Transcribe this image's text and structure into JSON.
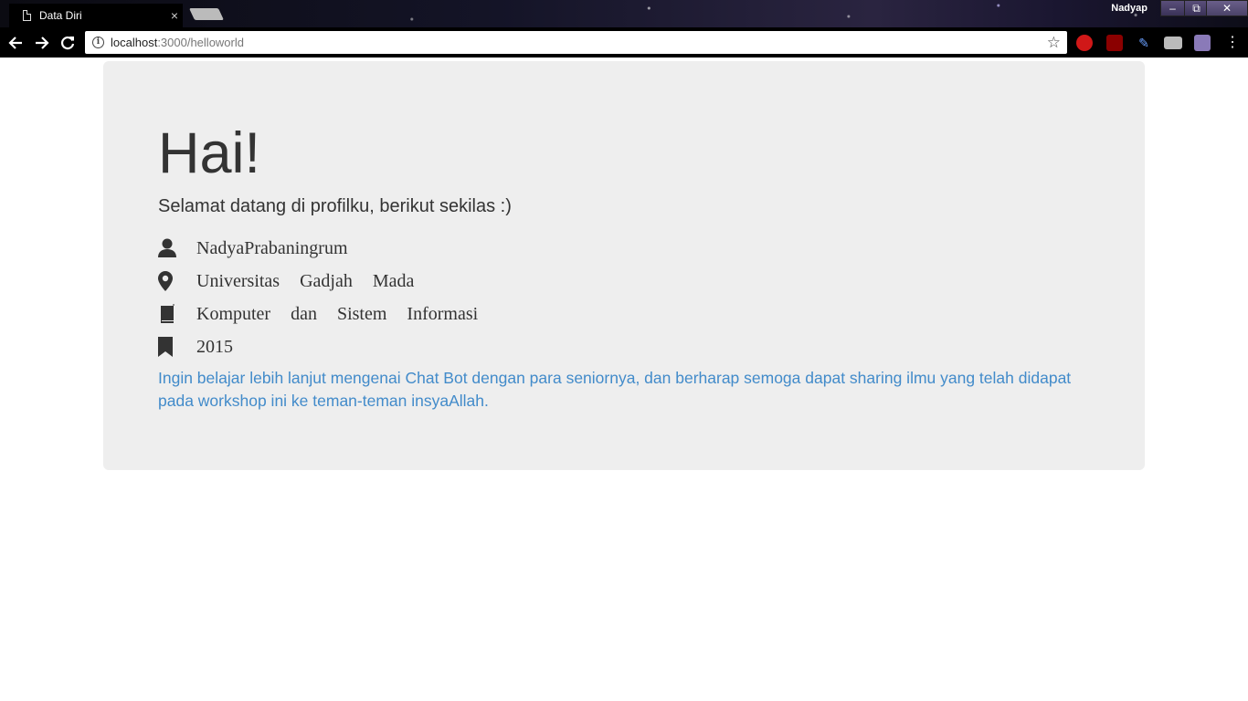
{
  "browser": {
    "tab_title": "Data Diri",
    "tab_close": "×",
    "profile_name": "Nadyap",
    "url_host": "localhost",
    "url_path": ":3000/helloworld",
    "window_buttons": {
      "minimize": "–",
      "restore": "⧉",
      "close": "✕"
    }
  },
  "page": {
    "heading": "Hai!",
    "subtitle": "Selamat datang di profilku, berikut sekilas :)",
    "info": [
      {
        "icon": "user-icon",
        "text": "NadyaPrabaningrum"
      },
      {
        "icon": "map-marker-icon",
        "text": "Universitas Gadjah Mada"
      },
      {
        "icon": "book-icon",
        "text": "Komputer dan Sistem Informasi"
      },
      {
        "icon": "bookmark-icon",
        "text": "2015"
      }
    ],
    "description": "Ingin belajar lebih lanjut mengenai Chat Bot dengan para seniornya, dan berharap semoga dapat sharing ilmu yang telah didapat pada workshop ini ke teman-teman insyaAllah."
  },
  "colors": {
    "jumbotron_bg": "#eeeeee",
    "text": "#333333",
    "link_blue": "#428bca"
  }
}
